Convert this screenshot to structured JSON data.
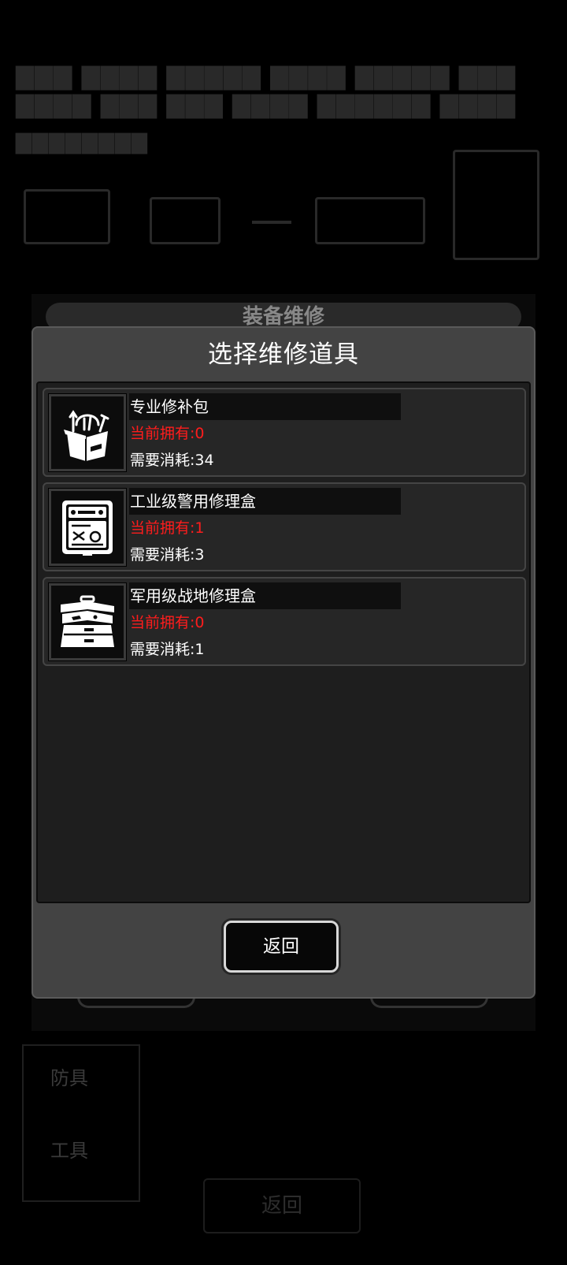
{
  "background": {
    "panel_title": "装备维修",
    "side_label_1": "防具",
    "side_label_2": "工具",
    "bottom_button": "返回"
  },
  "modal": {
    "title": "选择维修道具",
    "back_label": "返回"
  },
  "items": [
    {
      "name": "专业修补包",
      "owned": "当前拥有:0",
      "cost": "需要消耗:34",
      "icon": "repair-kit-bag-icon"
    },
    {
      "name": "工业级警用修理盒",
      "owned": "当前拥有:1",
      "cost": "需要消耗:3",
      "icon": "police-repair-case-icon"
    },
    {
      "name": "军用级战地修理盒",
      "owned": "当前拥有:0",
      "cost": "需要消耗:1",
      "icon": "military-toolbox-icon"
    }
  ],
  "colors": {
    "modal_bg": "#434343",
    "list_bg": "#1e1e1e",
    "owned_text": "#ff1c1c"
  }
}
